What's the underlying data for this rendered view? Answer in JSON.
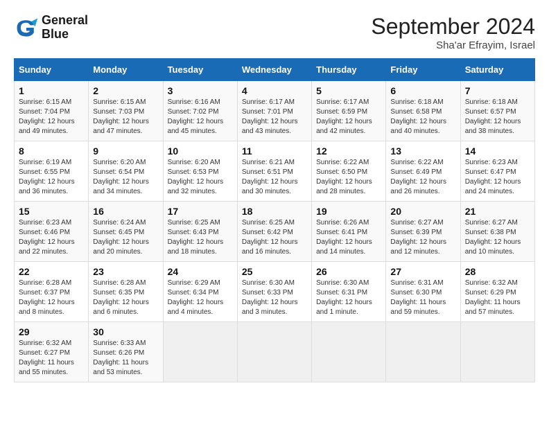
{
  "header": {
    "logo_line1": "General",
    "logo_line2": "Blue",
    "month": "September 2024",
    "location": "Sha'ar Efrayim, Israel"
  },
  "days_of_week": [
    "Sunday",
    "Monday",
    "Tuesday",
    "Wednesday",
    "Thursday",
    "Friday",
    "Saturday"
  ],
  "weeks": [
    [
      {
        "day": 1,
        "info": "Sunrise: 6:15 AM\nSunset: 7:04 PM\nDaylight: 12 hours\nand 49 minutes."
      },
      {
        "day": 2,
        "info": "Sunrise: 6:15 AM\nSunset: 7:03 PM\nDaylight: 12 hours\nand 47 minutes."
      },
      {
        "day": 3,
        "info": "Sunrise: 6:16 AM\nSunset: 7:02 PM\nDaylight: 12 hours\nand 45 minutes."
      },
      {
        "day": 4,
        "info": "Sunrise: 6:17 AM\nSunset: 7:01 PM\nDaylight: 12 hours\nand 43 minutes."
      },
      {
        "day": 5,
        "info": "Sunrise: 6:17 AM\nSunset: 6:59 PM\nDaylight: 12 hours\nand 42 minutes."
      },
      {
        "day": 6,
        "info": "Sunrise: 6:18 AM\nSunset: 6:58 PM\nDaylight: 12 hours\nand 40 minutes."
      },
      {
        "day": 7,
        "info": "Sunrise: 6:18 AM\nSunset: 6:57 PM\nDaylight: 12 hours\nand 38 minutes."
      }
    ],
    [
      {
        "day": 8,
        "info": "Sunrise: 6:19 AM\nSunset: 6:55 PM\nDaylight: 12 hours\nand 36 minutes."
      },
      {
        "day": 9,
        "info": "Sunrise: 6:20 AM\nSunset: 6:54 PM\nDaylight: 12 hours\nand 34 minutes."
      },
      {
        "day": 10,
        "info": "Sunrise: 6:20 AM\nSunset: 6:53 PM\nDaylight: 12 hours\nand 32 minutes."
      },
      {
        "day": 11,
        "info": "Sunrise: 6:21 AM\nSunset: 6:51 PM\nDaylight: 12 hours\nand 30 minutes."
      },
      {
        "day": 12,
        "info": "Sunrise: 6:22 AM\nSunset: 6:50 PM\nDaylight: 12 hours\nand 28 minutes."
      },
      {
        "day": 13,
        "info": "Sunrise: 6:22 AM\nSunset: 6:49 PM\nDaylight: 12 hours\nand 26 minutes."
      },
      {
        "day": 14,
        "info": "Sunrise: 6:23 AM\nSunset: 6:47 PM\nDaylight: 12 hours\nand 24 minutes."
      }
    ],
    [
      {
        "day": 15,
        "info": "Sunrise: 6:23 AM\nSunset: 6:46 PM\nDaylight: 12 hours\nand 22 minutes."
      },
      {
        "day": 16,
        "info": "Sunrise: 6:24 AM\nSunset: 6:45 PM\nDaylight: 12 hours\nand 20 minutes."
      },
      {
        "day": 17,
        "info": "Sunrise: 6:25 AM\nSunset: 6:43 PM\nDaylight: 12 hours\nand 18 minutes."
      },
      {
        "day": 18,
        "info": "Sunrise: 6:25 AM\nSunset: 6:42 PM\nDaylight: 12 hours\nand 16 minutes."
      },
      {
        "day": 19,
        "info": "Sunrise: 6:26 AM\nSunset: 6:41 PM\nDaylight: 12 hours\nand 14 minutes."
      },
      {
        "day": 20,
        "info": "Sunrise: 6:27 AM\nSunset: 6:39 PM\nDaylight: 12 hours\nand 12 minutes."
      },
      {
        "day": 21,
        "info": "Sunrise: 6:27 AM\nSunset: 6:38 PM\nDaylight: 12 hours\nand 10 minutes."
      }
    ],
    [
      {
        "day": 22,
        "info": "Sunrise: 6:28 AM\nSunset: 6:37 PM\nDaylight: 12 hours\nand 8 minutes."
      },
      {
        "day": 23,
        "info": "Sunrise: 6:28 AM\nSunset: 6:35 PM\nDaylight: 12 hours\nand 6 minutes."
      },
      {
        "day": 24,
        "info": "Sunrise: 6:29 AM\nSunset: 6:34 PM\nDaylight: 12 hours\nand 4 minutes."
      },
      {
        "day": 25,
        "info": "Sunrise: 6:30 AM\nSunset: 6:33 PM\nDaylight: 12 hours\nand 3 minutes."
      },
      {
        "day": 26,
        "info": "Sunrise: 6:30 AM\nSunset: 6:31 PM\nDaylight: 12 hours\nand 1 minute."
      },
      {
        "day": 27,
        "info": "Sunrise: 6:31 AM\nSunset: 6:30 PM\nDaylight: 11 hours\nand 59 minutes."
      },
      {
        "day": 28,
        "info": "Sunrise: 6:32 AM\nSunset: 6:29 PM\nDaylight: 11 hours\nand 57 minutes."
      }
    ],
    [
      {
        "day": 29,
        "info": "Sunrise: 6:32 AM\nSunset: 6:27 PM\nDaylight: 11 hours\nand 55 minutes."
      },
      {
        "day": 30,
        "info": "Sunrise: 6:33 AM\nSunset: 6:26 PM\nDaylight: 11 hours\nand 53 minutes."
      },
      null,
      null,
      null,
      null,
      null
    ]
  ]
}
